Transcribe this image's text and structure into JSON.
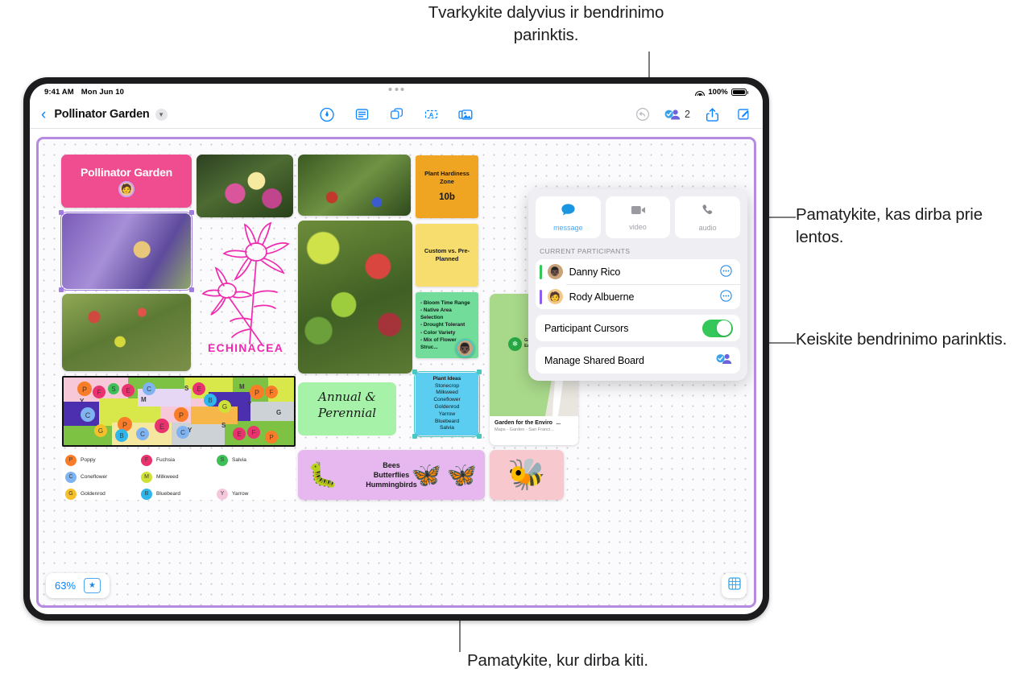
{
  "callouts": {
    "top": "Tvarkykite dalyvius ir bendrinimo parinktis.",
    "right_1": "Pamatykite, kas dirba prie lentos.",
    "right_2": "Keiskite bendrinimo parinktis.",
    "bottom": "Pamatykite, kur dirba kiti."
  },
  "statusbar": {
    "time": "9:41 AM",
    "date": "Mon Jun 10",
    "battery": "100%",
    "wifi_icon": "wifi-icon",
    "battery_icon": "battery-icon"
  },
  "toolbar": {
    "back_icon": "chevron-left-icon",
    "title": "Pollinator Garden",
    "title_chevron": "chevron-down-icon",
    "tools": [
      {
        "name": "pen-tool-icon",
        "label": "Pen"
      },
      {
        "name": "sticky-note-icon",
        "label": "Sticky Note"
      },
      {
        "name": "shapes-icon",
        "label": "Shapes"
      },
      {
        "name": "text-box-icon",
        "label": "Text Box"
      },
      {
        "name": "media-icon",
        "label": "Media"
      }
    ],
    "undo_icon": "undo-icon",
    "participants_icon": "participants-icon",
    "participants_count": "2",
    "share_icon": "share-icon",
    "compose_icon": "compose-icon"
  },
  "collab": {
    "modes": [
      {
        "label": "message",
        "icon": "message-bubble-icon",
        "active": true
      },
      {
        "label": "video",
        "icon": "video-camera-icon",
        "active": false
      },
      {
        "label": "audio",
        "icon": "phone-icon",
        "active": false
      }
    ],
    "section_title": "CURRENT PARTICIPANTS",
    "participants": [
      {
        "name": "Danny Rico",
        "color": "#34c759",
        "avatar_bg": "#c9a27a",
        "glyph": "👨🏿",
        "more_icon": "more-circle-icon"
      },
      {
        "name": "Rody Albuerne",
        "color": "#8e5df0",
        "avatar_bg": "#f3c98b",
        "glyph": "🧑",
        "more_icon": "more-circle-icon"
      }
    ],
    "cursors_label": "Participant Cursors",
    "cursors_on": true,
    "manage_label": "Manage Shared Board",
    "manage_icon": "manage-shared-icon"
  },
  "board": {
    "zoom_level": "63%",
    "star_icon": "star-icon",
    "grid_icon": "grid-icon",
    "title_card": {
      "text": "Pollinator Garden",
      "color": "#ef4d8f"
    },
    "stickies": [
      {
        "id": "hardiness",
        "title": "Plant Hardiness Zone",
        "big": "10b",
        "color": "#f0a522"
      },
      {
        "id": "custom",
        "title": "Custom vs. Pre-Planned",
        "color": "#f7dd6e"
      },
      {
        "id": "criteria",
        "color": "#72dd9a",
        "bullets": [
          "-  Bloom Time Range",
          "-  Native Area",
          "    Selection",
          "-  Drought Tolerant",
          "-  Color Variety",
          "-  Mix of Flower",
          "    Struc..."
        ]
      },
      {
        "id": "plant-ideas",
        "color": "#5bcdf0",
        "title": "Plant Ideas",
        "lines": [
          "Stonecrop",
          "Milkweed",
          "Coneflower",
          "Goldenrod",
          "Yarrow",
          "Bluebeard",
          "Salvia"
        ]
      }
    ],
    "sketch_label": "ECHINACEA",
    "handwritten": [
      "Annual &",
      "Perennial"
    ],
    "map_card": {
      "pin_label": "Garden for the Environment",
      "caption_title": "Garden for the Environ...",
      "caption_sub": "Maps - Garden - San Franci..."
    },
    "banner": {
      "lines": [
        "Bees",
        "Butterflies",
        "Hummingbirds"
      ],
      "color": "#e6b8ef"
    },
    "bee_card": {
      "glyph": "🐝",
      "color": "#f7c9cf"
    },
    "legend": [
      {
        "letter": "P",
        "name": "Poppy",
        "color": "#f97d28"
      },
      {
        "letter": "F",
        "name": "Fuchsia",
        "color": "#e8336e"
      },
      {
        "letter": "S",
        "name": "Salvia",
        "color": "#3fbf57"
      },
      {
        "letter": "C",
        "name": "Coneflower",
        "color": "#7fb3f2"
      },
      {
        "letter": "M",
        "name": "Milkweed",
        "color": "#cfe135"
      },
      {
        "letter": "G",
        "name": "Goldenrod",
        "color": "#f5c02a"
      },
      {
        "letter": "B",
        "name": "Bluebeard",
        "color": "#2fb6ea"
      },
      {
        "letter": "Y",
        "name": "Yarrow",
        "color": "#f6c6dd"
      }
    ]
  }
}
